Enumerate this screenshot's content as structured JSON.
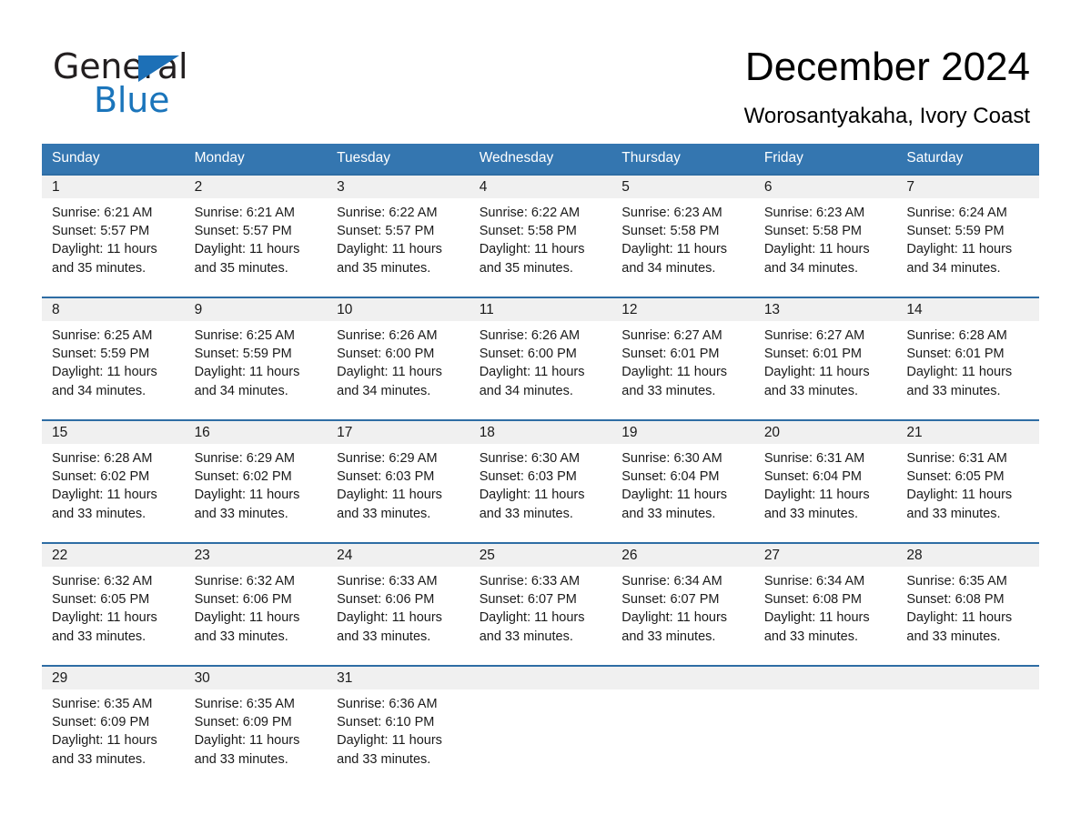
{
  "brand": {
    "name_part1": "General",
    "name_part2": "Blue",
    "triangle_icon": "triangle-icon",
    "accent_color": "#1b75bb"
  },
  "header": {
    "title": "December 2024",
    "subtitle": "Worosantyakaha, Ivory Coast"
  },
  "colors": {
    "header_blue": "#3476b0",
    "row_rule_blue": "#2e6da4",
    "daynum_band": "#f0f0f0",
    "logo_blue": "#1b75bb"
  },
  "weekday_headers": [
    "Sunday",
    "Monday",
    "Tuesday",
    "Wednesday",
    "Thursday",
    "Friday",
    "Saturday"
  ],
  "weeks": [
    [
      {
        "day": "1",
        "sunrise": "Sunrise: 6:21 AM",
        "sunset": "Sunset: 5:57 PM",
        "daylight1": "Daylight: 11 hours",
        "daylight2": "and 35 minutes."
      },
      {
        "day": "2",
        "sunrise": "Sunrise: 6:21 AM",
        "sunset": "Sunset: 5:57 PM",
        "daylight1": "Daylight: 11 hours",
        "daylight2": "and 35 minutes."
      },
      {
        "day": "3",
        "sunrise": "Sunrise: 6:22 AM",
        "sunset": "Sunset: 5:57 PM",
        "daylight1": "Daylight: 11 hours",
        "daylight2": "and 35 minutes."
      },
      {
        "day": "4",
        "sunrise": "Sunrise: 6:22 AM",
        "sunset": "Sunset: 5:58 PM",
        "daylight1": "Daylight: 11 hours",
        "daylight2": "and 35 minutes."
      },
      {
        "day": "5",
        "sunrise": "Sunrise: 6:23 AM",
        "sunset": "Sunset: 5:58 PM",
        "daylight1": "Daylight: 11 hours",
        "daylight2": "and 34 minutes."
      },
      {
        "day": "6",
        "sunrise": "Sunrise: 6:23 AM",
        "sunset": "Sunset: 5:58 PM",
        "daylight1": "Daylight: 11 hours",
        "daylight2": "and 34 minutes."
      },
      {
        "day": "7",
        "sunrise": "Sunrise: 6:24 AM",
        "sunset": "Sunset: 5:59 PM",
        "daylight1": "Daylight: 11 hours",
        "daylight2": "and 34 minutes."
      }
    ],
    [
      {
        "day": "8",
        "sunrise": "Sunrise: 6:25 AM",
        "sunset": "Sunset: 5:59 PM",
        "daylight1": "Daylight: 11 hours",
        "daylight2": "and 34 minutes."
      },
      {
        "day": "9",
        "sunrise": "Sunrise: 6:25 AM",
        "sunset": "Sunset: 5:59 PM",
        "daylight1": "Daylight: 11 hours",
        "daylight2": "and 34 minutes."
      },
      {
        "day": "10",
        "sunrise": "Sunrise: 6:26 AM",
        "sunset": "Sunset: 6:00 PM",
        "daylight1": "Daylight: 11 hours",
        "daylight2": "and 34 minutes."
      },
      {
        "day": "11",
        "sunrise": "Sunrise: 6:26 AM",
        "sunset": "Sunset: 6:00 PM",
        "daylight1": "Daylight: 11 hours",
        "daylight2": "and 34 minutes."
      },
      {
        "day": "12",
        "sunrise": "Sunrise: 6:27 AM",
        "sunset": "Sunset: 6:01 PM",
        "daylight1": "Daylight: 11 hours",
        "daylight2": "and 33 minutes."
      },
      {
        "day": "13",
        "sunrise": "Sunrise: 6:27 AM",
        "sunset": "Sunset: 6:01 PM",
        "daylight1": "Daylight: 11 hours",
        "daylight2": "and 33 minutes."
      },
      {
        "day": "14",
        "sunrise": "Sunrise: 6:28 AM",
        "sunset": "Sunset: 6:01 PM",
        "daylight1": "Daylight: 11 hours",
        "daylight2": "and 33 minutes."
      }
    ],
    [
      {
        "day": "15",
        "sunrise": "Sunrise: 6:28 AM",
        "sunset": "Sunset: 6:02 PM",
        "daylight1": "Daylight: 11 hours",
        "daylight2": "and 33 minutes."
      },
      {
        "day": "16",
        "sunrise": "Sunrise: 6:29 AM",
        "sunset": "Sunset: 6:02 PM",
        "daylight1": "Daylight: 11 hours",
        "daylight2": "and 33 minutes."
      },
      {
        "day": "17",
        "sunrise": "Sunrise: 6:29 AM",
        "sunset": "Sunset: 6:03 PM",
        "daylight1": "Daylight: 11 hours",
        "daylight2": "and 33 minutes."
      },
      {
        "day": "18",
        "sunrise": "Sunrise: 6:30 AM",
        "sunset": "Sunset: 6:03 PM",
        "daylight1": "Daylight: 11 hours",
        "daylight2": "and 33 minutes."
      },
      {
        "day": "19",
        "sunrise": "Sunrise: 6:30 AM",
        "sunset": "Sunset: 6:04 PM",
        "daylight1": "Daylight: 11 hours",
        "daylight2": "and 33 minutes."
      },
      {
        "day": "20",
        "sunrise": "Sunrise: 6:31 AM",
        "sunset": "Sunset: 6:04 PM",
        "daylight1": "Daylight: 11 hours",
        "daylight2": "and 33 minutes."
      },
      {
        "day": "21",
        "sunrise": "Sunrise: 6:31 AM",
        "sunset": "Sunset: 6:05 PM",
        "daylight1": "Daylight: 11 hours",
        "daylight2": "and 33 minutes."
      }
    ],
    [
      {
        "day": "22",
        "sunrise": "Sunrise: 6:32 AM",
        "sunset": "Sunset: 6:05 PM",
        "daylight1": "Daylight: 11 hours",
        "daylight2": "and 33 minutes."
      },
      {
        "day": "23",
        "sunrise": "Sunrise: 6:32 AM",
        "sunset": "Sunset: 6:06 PM",
        "daylight1": "Daylight: 11 hours",
        "daylight2": "and 33 minutes."
      },
      {
        "day": "24",
        "sunrise": "Sunrise: 6:33 AM",
        "sunset": "Sunset: 6:06 PM",
        "daylight1": "Daylight: 11 hours",
        "daylight2": "and 33 minutes."
      },
      {
        "day": "25",
        "sunrise": "Sunrise: 6:33 AM",
        "sunset": "Sunset: 6:07 PM",
        "daylight1": "Daylight: 11 hours",
        "daylight2": "and 33 minutes."
      },
      {
        "day": "26",
        "sunrise": "Sunrise: 6:34 AM",
        "sunset": "Sunset: 6:07 PM",
        "daylight1": "Daylight: 11 hours",
        "daylight2": "and 33 minutes."
      },
      {
        "day": "27",
        "sunrise": "Sunrise: 6:34 AM",
        "sunset": "Sunset: 6:08 PM",
        "daylight1": "Daylight: 11 hours",
        "daylight2": "and 33 minutes."
      },
      {
        "day": "28",
        "sunrise": "Sunrise: 6:35 AM",
        "sunset": "Sunset: 6:08 PM",
        "daylight1": "Daylight: 11 hours",
        "daylight2": "and 33 minutes."
      }
    ],
    [
      {
        "day": "29",
        "sunrise": "Sunrise: 6:35 AM",
        "sunset": "Sunset: 6:09 PM",
        "daylight1": "Daylight: 11 hours",
        "daylight2": "and 33 minutes."
      },
      {
        "day": "30",
        "sunrise": "Sunrise: 6:35 AM",
        "sunset": "Sunset: 6:09 PM",
        "daylight1": "Daylight: 11 hours",
        "daylight2": "and 33 minutes."
      },
      {
        "day": "31",
        "sunrise": "Sunrise: 6:36 AM",
        "sunset": "Sunset: 6:10 PM",
        "daylight1": "Daylight: 11 hours",
        "daylight2": "and 33 minutes."
      },
      {
        "day": "",
        "sunrise": "",
        "sunset": "",
        "daylight1": "",
        "daylight2": ""
      },
      {
        "day": "",
        "sunrise": "",
        "sunset": "",
        "daylight1": "",
        "daylight2": ""
      },
      {
        "day": "",
        "sunrise": "",
        "sunset": "",
        "daylight1": "",
        "daylight2": ""
      },
      {
        "day": "",
        "sunrise": "",
        "sunset": "",
        "daylight1": "",
        "daylight2": ""
      }
    ]
  ]
}
